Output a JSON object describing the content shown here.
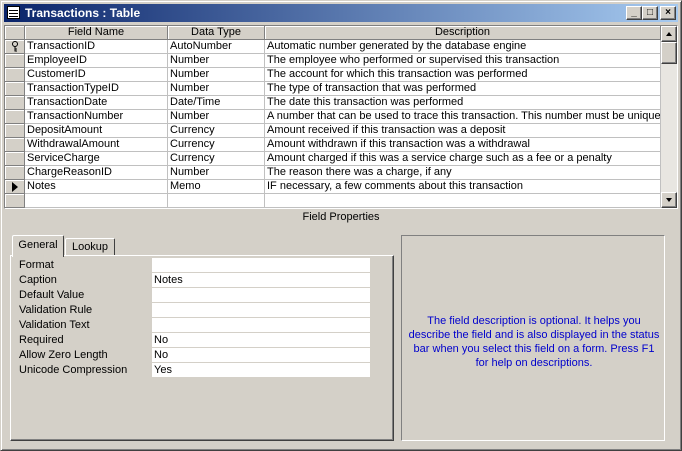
{
  "window": {
    "title": "Transactions : Table",
    "buttons": {
      "minimize": "_",
      "maximize": "□",
      "close": "×"
    }
  },
  "grid": {
    "headers": {
      "field_name": "Field Name",
      "data_type": "Data Type",
      "description": "Description"
    },
    "rows": [
      {
        "field": "TransactionID",
        "type": "AutoNumber",
        "desc": "Automatic number generated by the database engine",
        "indicator": "key"
      },
      {
        "field": "EmployeeID",
        "type": "Number",
        "desc": "The employee who performed or supervised this transaction",
        "indicator": ""
      },
      {
        "field": "CustomerID",
        "type": "Number",
        "desc": "The account for which this transaction was performed",
        "indicator": ""
      },
      {
        "field": "TransactionTypeID",
        "type": "Number",
        "desc": "The type of transaction that was performed",
        "indicator": ""
      },
      {
        "field": "TransactionDate",
        "type": "Date/Time",
        "desc": "The date this transaction was performed",
        "indicator": ""
      },
      {
        "field": "TransactionNumber",
        "type": "Number",
        "desc": "A number that can be used to trace this transaction. This number must be unique",
        "indicator": ""
      },
      {
        "field": "DepositAmount",
        "type": "Currency",
        "desc": "Amount received if this transaction was a deposit",
        "indicator": ""
      },
      {
        "field": "WithdrawalAmount",
        "type": "Currency",
        "desc": "Amount withdrawn if this transaction was a withdrawal",
        "indicator": ""
      },
      {
        "field": "ServiceCharge",
        "type": "Currency",
        "desc": "Amount charged if this was a service charge such as a fee or a penalty",
        "indicator": ""
      },
      {
        "field": "ChargeReasonID",
        "type": "Number",
        "desc": "The reason there was a charge, if any",
        "indicator": ""
      },
      {
        "field": "Notes",
        "type": "Memo",
        "desc": "IF necessary, a few comments about this transaction",
        "indicator": "current"
      },
      {
        "field": "",
        "type": "",
        "desc": "",
        "indicator": ""
      }
    ]
  },
  "field_properties": {
    "title": "Field Properties",
    "tabs": [
      {
        "label": "General",
        "active": true
      },
      {
        "label": "Lookup",
        "active": false
      }
    ],
    "properties": [
      {
        "label": "Format",
        "value": ""
      },
      {
        "label": "Caption",
        "value": "Notes"
      },
      {
        "label": "Default Value",
        "value": ""
      },
      {
        "label": "Validation Rule",
        "value": ""
      },
      {
        "label": "Validation Text",
        "value": ""
      },
      {
        "label": "Required",
        "value": "No"
      },
      {
        "label": "Allow Zero Length",
        "value": "No"
      },
      {
        "label": "Unicode Compression",
        "value": "Yes"
      }
    ],
    "help_text": "The field description is optional.  It helps you describe the field and is also displayed in the status bar when you select this field on a form.  Press F1 for help on descriptions."
  },
  "colors": {
    "title_bar": "#0a246a",
    "help_text": "#0000cc",
    "face": "#d4d0c8"
  }
}
